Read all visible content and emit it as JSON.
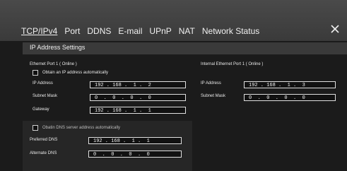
{
  "tabs": [
    {
      "label": "TCP/IPv4",
      "active": true
    },
    {
      "label": "Port"
    },
    {
      "label": "DDNS"
    },
    {
      "label": "E-mail"
    },
    {
      "label": "UPnP"
    },
    {
      "label": "NAT"
    },
    {
      "label": "Network Status"
    }
  ],
  "section_title": "IP Address Settings",
  "ethernet": {
    "title": "Ethernet Port 1 ( Online )",
    "auto_ip_label": "Obtain an IP address automatically",
    "fields": [
      {
        "label": "IP Address",
        "value": "192 . 168 .  1 .  2"
      },
      {
        "label": "Subnet Mask",
        "value": "0  .  0  .  0  .  0"
      },
      {
        "label": "Gateway",
        "value": "192 . 168 .  1 .  1"
      }
    ]
  },
  "internal": {
    "title": "Internal Ethernet Port 1 ( Online )",
    "fields": [
      {
        "label": "IP Address",
        "value": "192 . 168 .  1 .  3"
      },
      {
        "label": "Subnet Mask",
        "value": "0  .  0  .  0  .  0"
      }
    ]
  },
  "dns": {
    "auto_label": "Obatin DNS server address automatically",
    "fields": [
      {
        "label": "Preferred DNS",
        "value": "192 . 168 .  1 .  1"
      },
      {
        "label": "Alternate DNS",
        "value": "0  .  0  .  0  .  0"
      }
    ]
  }
}
